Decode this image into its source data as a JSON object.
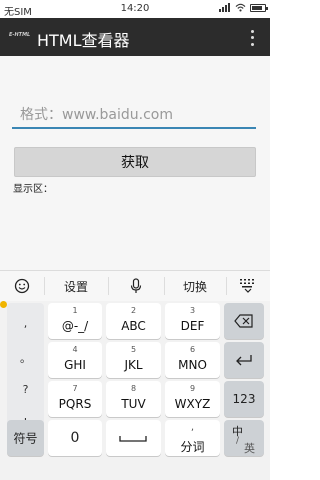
{
  "status_bar": {
    "carrier": "无SIM",
    "time": "14:20",
    "battery_level": 0.8
  },
  "app_bar": {
    "logo_text": "E-HTML",
    "title": "HTML查看器",
    "menu_icon": "more-vertical-icon"
  },
  "form": {
    "url_placeholder": "格式：www.baidu.com",
    "url_value": "",
    "fetch_label": "获取",
    "display_label": "显示区："
  },
  "keyboard": {
    "toolbar": {
      "emoji_icon": "emoji-icon",
      "settings_label": "设置",
      "voice_icon": "microphone-icon",
      "switch_label": "切换",
      "collapse_icon": "keyboard-collapse-icon"
    },
    "punctuation": [
      ",",
      "。",
      "?",
      "!"
    ],
    "keys": [
      {
        "num": "1",
        "label": "@-_/"
      },
      {
        "num": "2",
        "label": "ABC"
      },
      {
        "num": "3",
        "label": "DEF"
      },
      {
        "num": "4",
        "label": "GHI"
      },
      {
        "num": "5",
        "label": "JKL"
      },
      {
        "num": "6",
        "label": "MNO"
      },
      {
        "num": "7",
        "label": "PQRS"
      },
      {
        "num": "8",
        "label": "TUV"
      },
      {
        "num": "9",
        "label": "WXYZ"
      }
    ],
    "symbols_label": "符号",
    "zero_label": "0",
    "comma_label": ",",
    "word_label": "分词",
    "digits_label": "123",
    "lang_zh": "中",
    "lang_en": "英",
    "delete_icon": "backspace-icon",
    "enter_icon": "enter-icon",
    "space_icon": "space-icon"
  },
  "colors": {
    "app_bar": "#2c2c2c",
    "accent": "#3a86b4",
    "input_indicator": "#f0b400"
  }
}
